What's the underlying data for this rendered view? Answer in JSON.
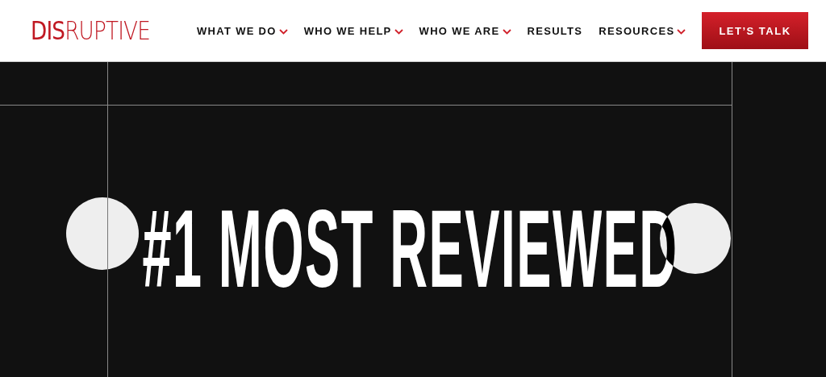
{
  "header": {
    "logo": "**DIS**RUPTIVE",
    "nav": [
      {
        "label": "WHAT WE DO",
        "has_dropdown": true
      },
      {
        "label": "WHO WE HELP",
        "has_dropdown": true
      },
      {
        "label": "WHO WE ARE",
        "has_dropdown": true
      },
      {
        "label": "RESULTS",
        "has_dropdown": false
      },
      {
        "label": "RESOURCES",
        "has_dropdown": true
      }
    ],
    "cta": "LET’S TALK"
  },
  "hero": {
    "headline": "#1 MOST REVIEWED"
  }
}
